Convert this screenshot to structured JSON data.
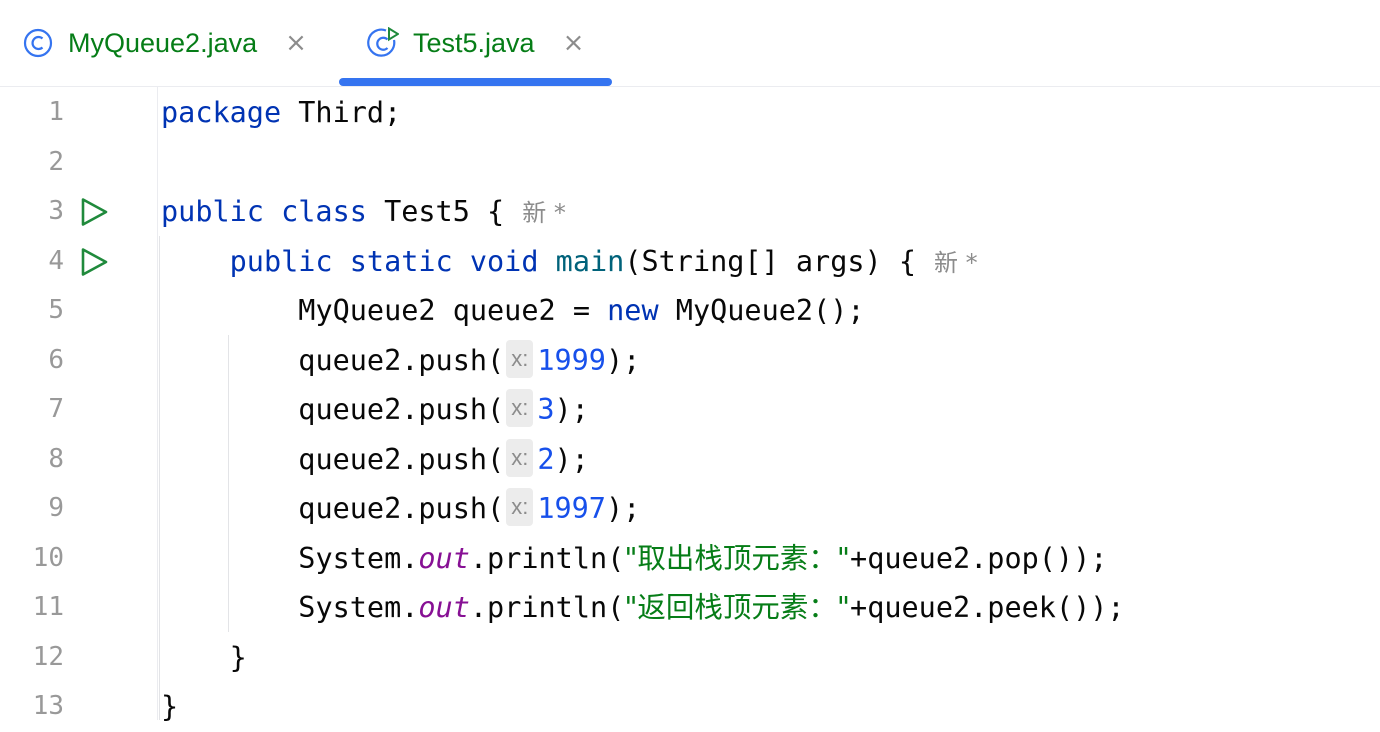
{
  "tabs": [
    {
      "label": "MyQueue2.java",
      "icon": "class-icon",
      "close": "×",
      "active": false
    },
    {
      "label": "Test5.java",
      "icon": "runnable-class-icon",
      "close": "×",
      "active": true
    }
  ],
  "editor": {
    "line_numbers": [
      "1",
      "2",
      "3",
      "4",
      "5",
      "6",
      "7",
      "8",
      "9",
      "10",
      "11",
      "12",
      "13"
    ],
    "tokens": {
      "l1_kw": "package",
      "l1_rest": " Third;",
      "l3_kw": "public class",
      "l3_rest": " Test5 {",
      "l3_inlay": "新 *",
      "l4_kw1": "public static void",
      "l4_fn": "main",
      "l4_rest": "(String[] args) {",
      "l4_inlay": "新 *",
      "l5_a": "MyQueue2 queue2 = ",
      "l5_kw": "new",
      "l5_b": " MyQueue2();",
      "push_call": "queue2.push(",
      "hint_x": "x:",
      "l6_num": "1999",
      "l7_num": "3",
      "l8_num": "2",
      "l9_num": "1997",
      "close_semi": ");",
      "sys": "System.",
      "out": "out",
      "println": ".println(",
      "l10_str": "\"取出栈顶元素：\"",
      "l10_rest": "+queue2.pop());",
      "l11_str": "\"返回栈顶元素：\"",
      "l11_rest": "+queue2.peek());",
      "l12": "}",
      "l13": "}"
    }
  },
  "colors": {
    "keyword": "#0033b3",
    "number": "#1750eb",
    "string": "#067d17",
    "field": "#871094",
    "accent": "#3574f0",
    "run": "#208a3c"
  }
}
